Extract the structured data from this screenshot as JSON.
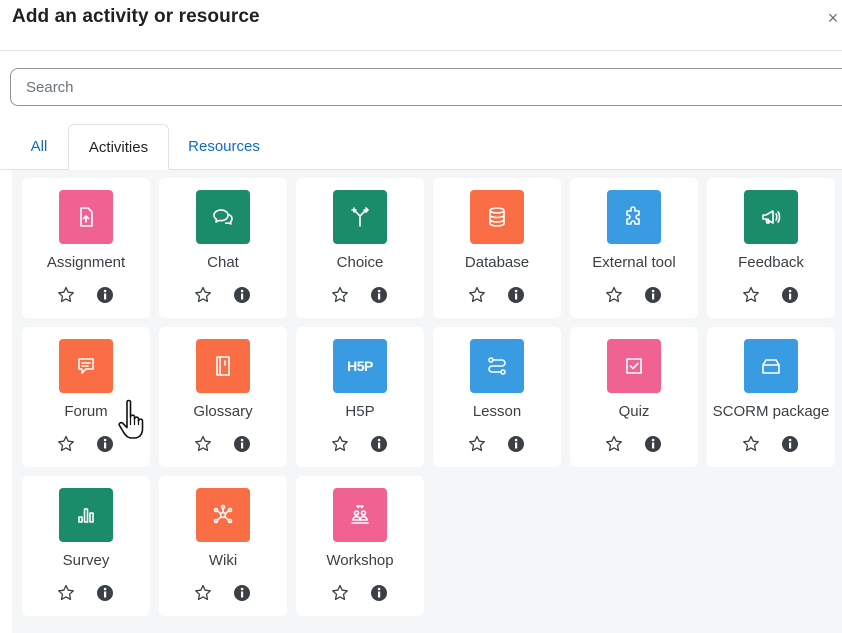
{
  "modal": {
    "title": "Add an activity or resource",
    "close_glyph": "×"
  },
  "search": {
    "placeholder": "Search",
    "value": ""
  },
  "tabs": [
    {
      "label": "All",
      "active": false
    },
    {
      "label": "Activities",
      "active": true
    },
    {
      "label": "Resources",
      "active": false
    }
  ],
  "colors": {
    "pink": "#f06292",
    "green": "#1b8c6a",
    "orange": "#fa6e45",
    "blue": "#399be2",
    "link": "#0f6cbf"
  },
  "items": [
    {
      "name": "Assignment",
      "icon": "assignment-icon",
      "color": "pink"
    },
    {
      "name": "Chat",
      "icon": "chat-icon",
      "color": "green"
    },
    {
      "name": "Choice",
      "icon": "choice-icon",
      "color": "green"
    },
    {
      "name": "Database",
      "icon": "database-icon",
      "color": "orange"
    },
    {
      "name": "External tool",
      "icon": "puzzle-icon",
      "color": "blue"
    },
    {
      "name": "Feedback",
      "icon": "megaphone-icon",
      "color": "green"
    },
    {
      "name": "Forum",
      "icon": "forum-icon",
      "color": "orange"
    },
    {
      "name": "Glossary",
      "icon": "glossary-icon",
      "color": "orange"
    },
    {
      "name": "H5P",
      "icon": "h5p-icon",
      "color": "blue"
    },
    {
      "name": "Lesson",
      "icon": "lesson-icon",
      "color": "blue"
    },
    {
      "name": "Quiz",
      "icon": "quiz-icon",
      "color": "pink"
    },
    {
      "name": "SCORM package",
      "icon": "scorm-icon",
      "color": "blue"
    },
    {
      "name": "Survey",
      "icon": "survey-icon",
      "color": "green"
    },
    {
      "name": "Wiki",
      "icon": "wiki-icon",
      "color": "orange"
    },
    {
      "name": "Workshop",
      "icon": "workshop-icon",
      "color": "pink"
    }
  ],
  "h5p_text": "H5P"
}
